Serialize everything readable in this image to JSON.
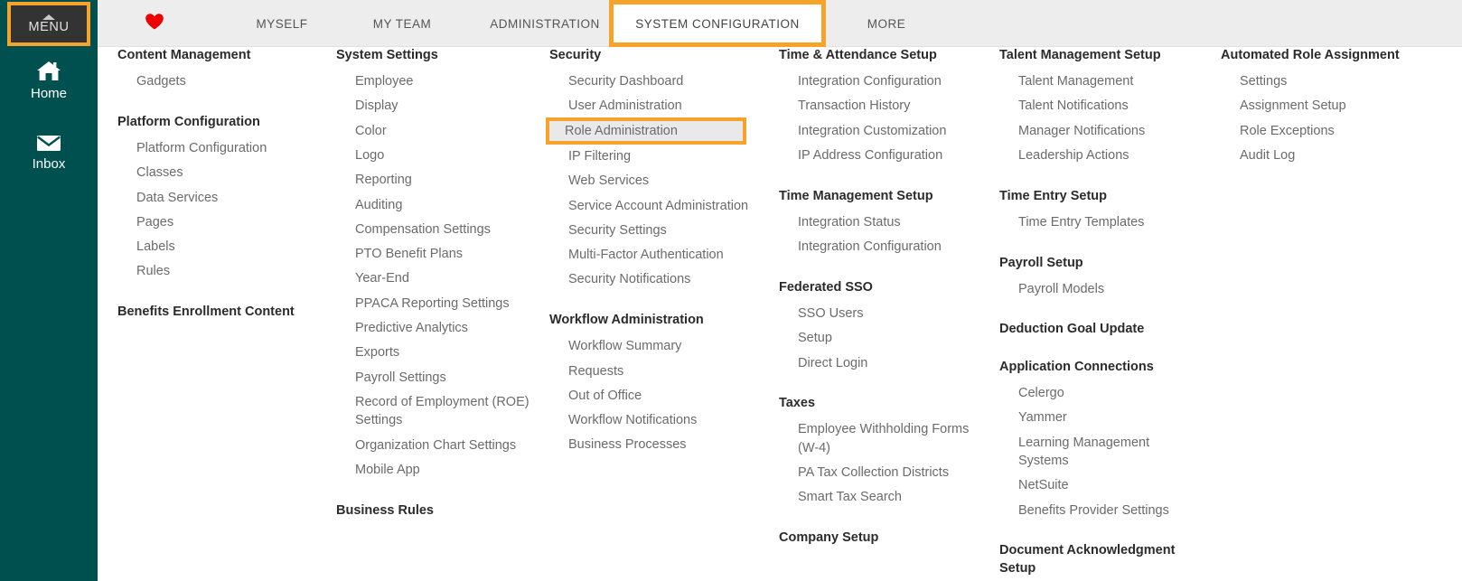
{
  "sidebar": {
    "menu_button": {
      "label": "MENU",
      "icon": "caret-up-icon"
    },
    "items": [
      {
        "label": "Home",
        "icon": "home-icon"
      },
      {
        "label": "Inbox",
        "icon": "envelope-icon"
      }
    ],
    "background_color": "#005050"
  },
  "topnav": {
    "favorites_icon": "heart-icon",
    "tabs": [
      {
        "label": "MYSELF",
        "active": false
      },
      {
        "label": "MY TEAM",
        "active": false
      },
      {
        "label": "ADMINISTRATION",
        "active": false
      },
      {
        "label": "SYSTEM CONFIGURATION",
        "active": true
      },
      {
        "label": "MORE",
        "active": false
      }
    ],
    "background_color": "#ededed",
    "highlight_color": "#f5a32a"
  },
  "megamenu": {
    "columns": [
      {
        "groups": [
          {
            "title": "Content Management",
            "items": [
              "Gadgets"
            ]
          },
          {
            "title": "Platform Configuration",
            "items": [
              "Platform Configuration",
              "Classes",
              "Data Services",
              "Pages",
              "Labels",
              "Rules"
            ]
          },
          {
            "title": "Benefits Enrollment Content",
            "items": []
          }
        ]
      },
      {
        "groups": [
          {
            "title": "System Settings",
            "items": [
              "Employee",
              "Display",
              "Color",
              "Logo",
              "Reporting",
              "Auditing",
              "Compensation Settings",
              "PTO Benefit Plans",
              "Year-End",
              "PPACA Reporting Settings",
              "Predictive Analytics",
              "Exports",
              "Payroll Settings",
              "Record of Employment (ROE) Settings",
              "Organization Chart Settings",
              "Mobile App"
            ]
          },
          {
            "title": "Business Rules",
            "items": []
          }
        ]
      },
      {
        "groups": [
          {
            "title": "Security",
            "items": [
              "Security Dashboard",
              "User Administration",
              "Role Administration",
              "IP Filtering",
              "Web Services",
              "Service Account Administration",
              "Security Settings",
              "Multi-Factor Authentication",
              "Security Notifications"
            ],
            "highlighted_item": "Role Administration"
          },
          {
            "title": "Workflow Administration",
            "items": [
              "Workflow Summary",
              "Requests",
              "Out of Office",
              "Workflow Notifications",
              "Business Processes"
            ]
          }
        ]
      },
      {
        "groups": [
          {
            "title": "Time & Attendance Setup",
            "items": [
              "Integration Configuration",
              "Transaction History",
              "Integration Customization",
              "IP Address Configuration"
            ]
          },
          {
            "title": "Time Management Setup",
            "items": [
              "Integration Status",
              "Integration Configuration"
            ]
          },
          {
            "title": "Federated SSO",
            "items": [
              "SSO Users",
              "Setup",
              "Direct Login"
            ]
          },
          {
            "title": "Taxes",
            "items": [
              "Employee Withholding Forms (W-4)",
              "PA Tax Collection Districts",
              "Smart Tax Search"
            ]
          },
          {
            "title": "Company Setup",
            "items": []
          }
        ]
      },
      {
        "groups": [
          {
            "title": "Talent Management Setup",
            "items": [
              "Talent Management",
              "Talent Notifications",
              "Manager Notifications",
              "Leadership Actions"
            ]
          },
          {
            "title": "Time Entry Setup",
            "items": [
              "Time Entry Templates"
            ]
          },
          {
            "title": "Payroll Setup",
            "items": [
              "Payroll Models"
            ]
          },
          {
            "title": "Deduction Goal Update",
            "items": []
          },
          {
            "title": "Application Connections",
            "items": [
              "Celergo",
              "Yammer",
              "Learning Management Systems",
              "NetSuite",
              "Benefits Provider Settings"
            ]
          },
          {
            "title": "Document Acknowledgment Setup",
            "items": []
          }
        ]
      },
      {
        "groups": [
          {
            "title": "Automated Role Assignment",
            "items": [
              "Settings",
              "Assignment Setup",
              "Role Exceptions",
              "Audit Log"
            ]
          }
        ]
      }
    ]
  }
}
